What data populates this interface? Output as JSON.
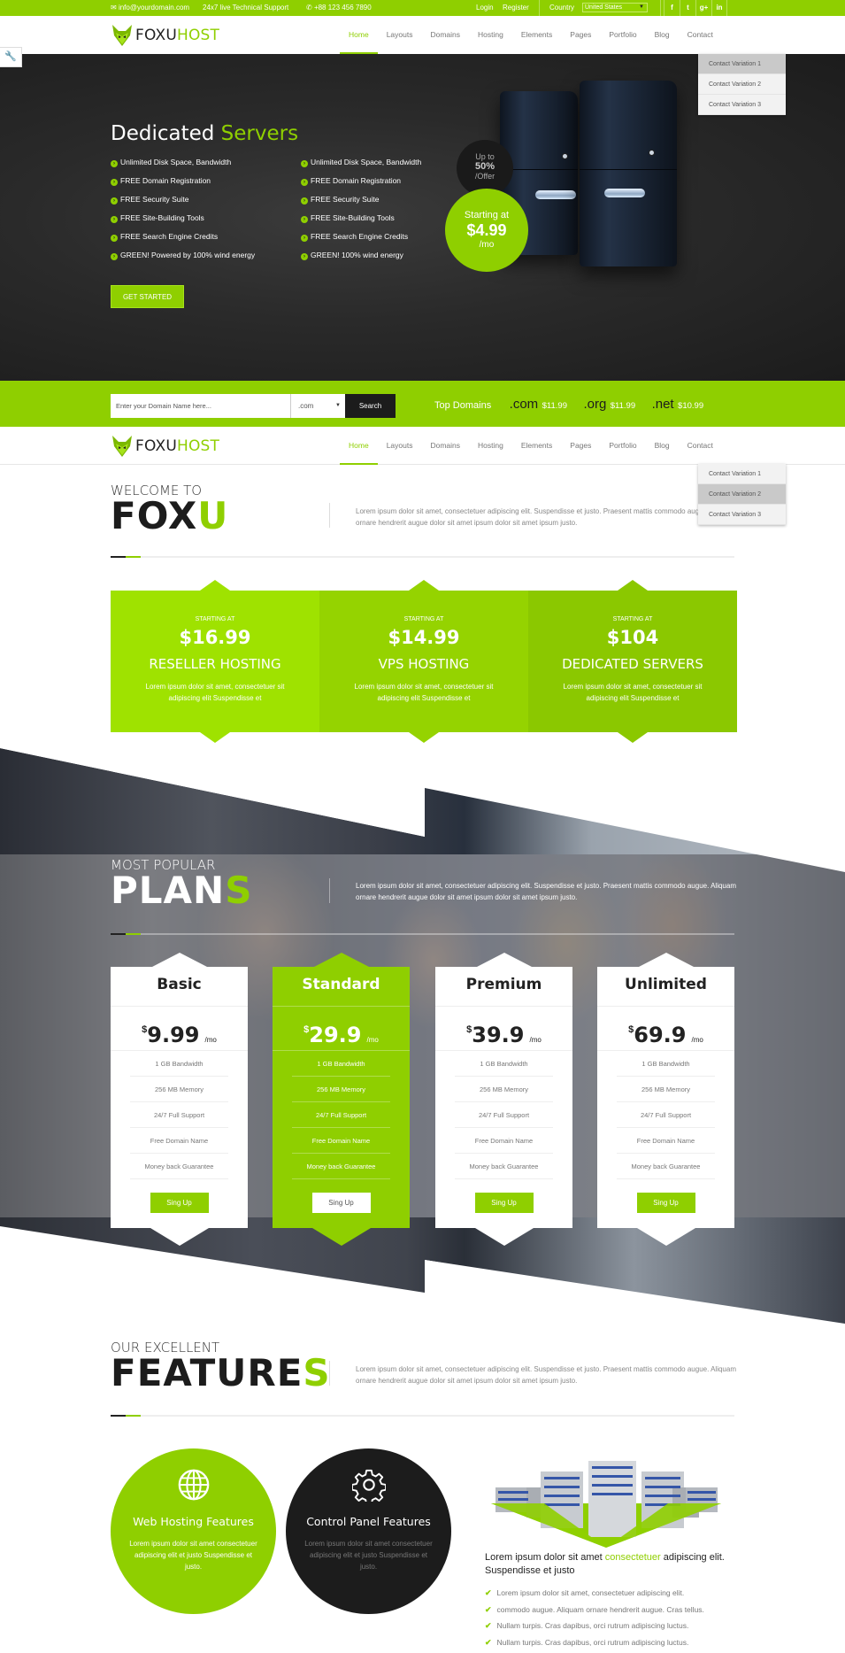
{
  "topbar": {
    "email": "info@yourdomain.com",
    "support": "24x7 live Technical Support",
    "phone": "+88 123 456 7890",
    "login": "Login",
    "register": "Register",
    "country_label": "Country",
    "country_value": "United States",
    "social": [
      {
        "icon": "facebook-icon",
        "glyph": "f"
      },
      {
        "icon": "twitter-icon",
        "glyph": "t"
      },
      {
        "icon": "google-plus-icon",
        "glyph": "g+"
      },
      {
        "icon": "linkedin-icon",
        "glyph": "in"
      }
    ]
  },
  "brand": {
    "part1": "FOXU",
    "part2": "HOST",
    "accent": "#8fcf00"
  },
  "nav": {
    "items": [
      "Home",
      "Layouts",
      "Domains",
      "Hosting",
      "Elements",
      "Pages",
      "Portfolio",
      "Blog",
      "Contact"
    ],
    "active": "Home",
    "contact_menu": [
      "Contact Variation 1",
      "Contact Variation 2",
      "Contact Variation 3"
    ]
  },
  "hero": {
    "title_white": "Dedicated",
    "title_green": "Servers",
    "features_left": [
      "Unlimited Disk Space, Bandwidth",
      "FREE Domain Registration",
      "FREE Security Suite",
      "FREE Site-Building Tools",
      "FREE Search Engine Credits",
      "GREEN! Powered by 100% wind energy"
    ],
    "features_right": [
      "Unlimited Disk Space, Bandwidth",
      "FREE Domain Registration",
      "FREE Security Suite",
      "FREE Site-Building Tools",
      "FREE Search Engine Credits",
      "GREEN! 100% wind energy"
    ],
    "cta": "GET STARTED",
    "offer": {
      "line1": "Up to",
      "line2": "50%",
      "line3": "/Offer"
    },
    "price_badge": {
      "line1": "Starting at",
      "price": "$4.99",
      "period": "/mo"
    }
  },
  "domain_search": {
    "placeholder": "Enter your Domain Name here...",
    "tld_selected": ".com",
    "button": "Search",
    "top_label": "Top Domains",
    "top": [
      {
        "ext": ".com",
        "price": "$11.99"
      },
      {
        "ext": ".org",
        "price": "$11.99"
      },
      {
        "ext": ".net",
        "price": "$10.99"
      }
    ]
  },
  "welcome": {
    "small": "WELCOME TO",
    "big_dark": "FOX",
    "big_green": "U",
    "text": "Lorem ipsum dolor sit amet, consectetuer adipiscing elit. Suspendisse et justo. Praesent mattis commodo augue. Aliquam ornare hendrerit augue dolor sit amet ipsum dolor sit amet ipsum justo."
  },
  "services": [
    {
      "label": "STARTING AT",
      "price": "$16.99",
      "name": "RESELLER HOSTING",
      "desc": "Lorem ipsum dolor sit amet, consectetuer sit adipiscing elit Suspendisse et",
      "color": "#9fe200"
    },
    {
      "label": "STARTING AT",
      "price": "$14.99",
      "name": "VPS HOSTING",
      "desc": "Lorem ipsum dolor sit amet, consectetuer sit adipiscing elit Suspendisse et",
      "color": "#95d300"
    },
    {
      "label": "STARTING AT",
      "price": "$104",
      "name": "DEDICATED SERVERS",
      "desc": "Lorem ipsum dolor sit amet, consectetuer sit adipiscing elit Suspendisse et",
      "color": "#8bc800"
    }
  ],
  "plans_section": {
    "small": "MOST POPULAR",
    "big_white": "PLAN",
    "big_green": "S",
    "text": "Lorem ipsum dolor sit amet, consectetuer adipiscing elit. Suspendisse et justo. Praesent mattis commodo augue. Aliquam ornare hendrerit augue dolor sit amet ipsum dolor sit amet ipsum justo."
  },
  "plans": [
    {
      "name": "Basic",
      "currency": "$",
      "price": "9.99",
      "period": "/mo",
      "featured": false,
      "features": [
        "1 GB Bandwidth",
        "256 MB Memory",
        "24/7 Full Support",
        "Free Domain Name",
        "Money back Guarantee"
      ],
      "button": "Sing Up"
    },
    {
      "name": "Standard",
      "currency": "$",
      "price": "29.9",
      "period": "/mo",
      "featured": true,
      "features": [
        "1 GB Bandwidth",
        "256 MB Memory",
        "24/7 Full Support",
        "Free Domain Name",
        "Money back Guarantee"
      ],
      "button": "Sing Up"
    },
    {
      "name": "Premium",
      "currency": "$",
      "price": "39.9",
      "period": "/mo",
      "featured": false,
      "features": [
        "1 GB Bandwidth",
        "256 MB Memory",
        "24/7 Full Support",
        "Free Domain Name",
        "Money back Guarantee"
      ],
      "button": "Sing Up"
    },
    {
      "name": "Unlimited",
      "currency": "$",
      "price": "69.9",
      "period": "/mo",
      "featured": false,
      "features": [
        "1 GB Bandwidth",
        "256 MB Memory",
        "24/7 Full Support",
        "Free Domain Name",
        "Money back Guarantee"
      ],
      "button": "Sing Up"
    }
  ],
  "features_section": {
    "small": "OUR EXCELLENT",
    "big_dark": "FEATURE",
    "big_green": "S",
    "text": "Lorem ipsum dolor sit amet, consectetuer adipiscing elit. Suspendisse et justo. Praesent mattis commodo augue. Aliquam ornare hendrerit augue dolor sit amet ipsum dolor sit amet ipsum justo.",
    "circles": [
      {
        "icon": "globe-icon",
        "title": "Web Hosting Features",
        "desc": "Lorem ipsum dolor sit amet consectetuer adipiscing elit et justo Suspendisse et justo."
      },
      {
        "icon": "gear-icon",
        "title": "Control Panel Features",
        "desc": "Lorem ipsum dolor sit amet consectetuer adipiscing elit et justo Suspendisse et justo."
      }
    ],
    "para_before": "Lorem ipsum dolor sit amet ",
    "para_green": "consectetuer",
    "para_after": " adipiscing elit. Suspendisse et justo",
    "checklist": [
      "Lorem ipsum dolor sit amet, consectetuer adipiscing elit.",
      "commodo augue. Aliquam ornare hendrerit augue. Cras tellus.",
      "Nullam turpis. Cras dapibus, orci rutrum adipiscing luctus.",
      "Nullam turpis. Cras dapibus, orci rutrum adipiscing luctus."
    ]
  }
}
